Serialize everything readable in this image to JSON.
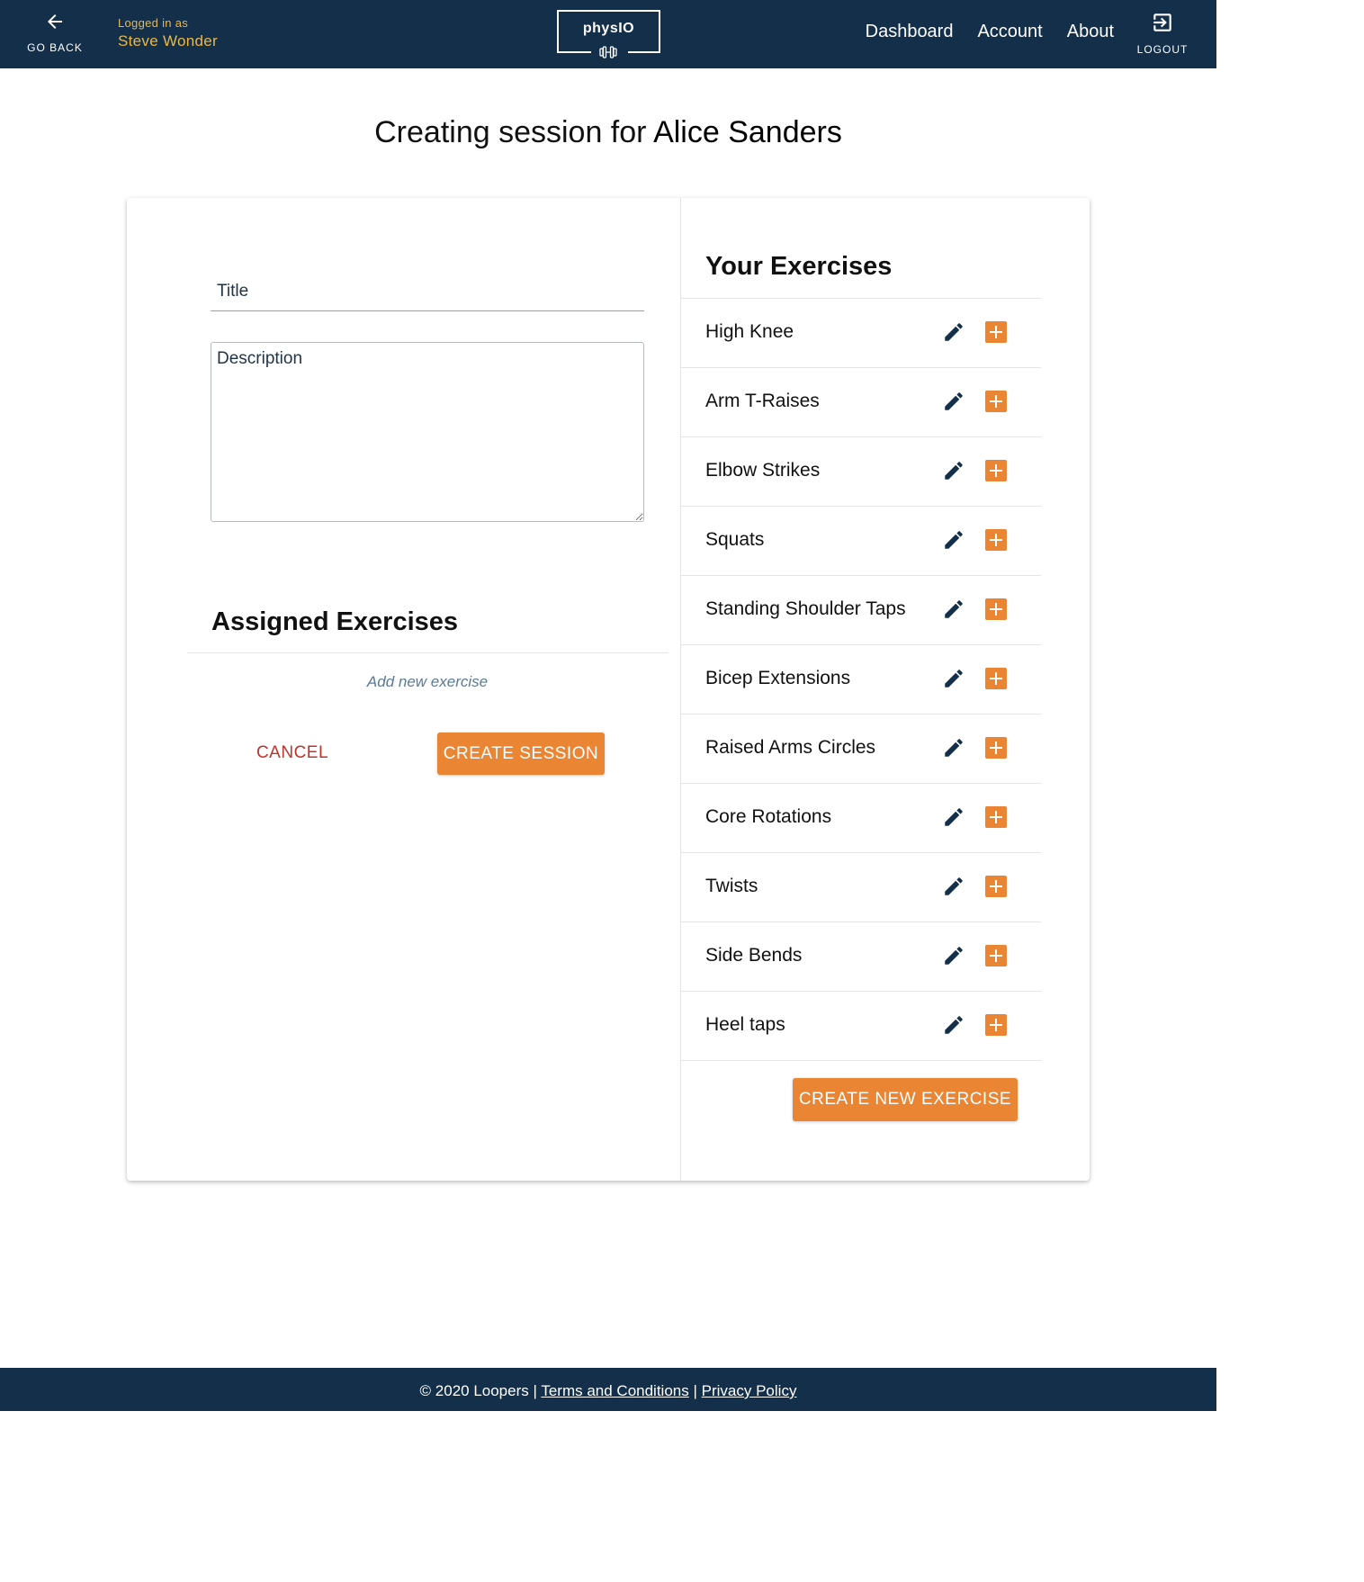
{
  "nav": {
    "go_back_label": "GO BACK",
    "logged_in_label": "Logged in as",
    "user_name": "Steve Wonder",
    "brand": "physIO",
    "links": [
      "Dashboard",
      "Account",
      "About"
    ],
    "logout_label": "LOGOUT"
  },
  "page": {
    "title_prefix": "Creating session for",
    "patient_name": "Alice Sanders"
  },
  "form": {
    "title_placeholder": "Title",
    "title_value": "",
    "description_placeholder": "Description",
    "description_value": ""
  },
  "assigned": {
    "heading": "Assigned Exercises",
    "add_new_label": "Add new exercise",
    "cancel_label": "CANCEL",
    "create_label": "CREATE SESSION"
  },
  "exercises": {
    "heading": "Your Exercises",
    "items": [
      "High Knee",
      "Arm T-Raises",
      "Elbow Strikes",
      "Squats",
      "Standing Shoulder Taps",
      "Bicep Extensions",
      "Raised Arms Circles",
      "Core Rotations",
      "Twists",
      "Side Bends",
      "Heel taps"
    ],
    "create_new_label": "CREATE NEW EXERCISE"
  },
  "footer": {
    "copyright": "© 2020 Loopers |",
    "terms": "Terms and Conditions",
    "separator": "|",
    "privacy": "Privacy Policy"
  },
  "colors": {
    "navy": "#132f4a",
    "accent": "#e98533",
    "user_gold": "#e8b84a",
    "cancel_red": "#c0332b"
  },
  "icons": {
    "go_back": "arrow-left-icon",
    "brand": "dumbbell-icon",
    "logout": "logout-icon",
    "edit": "pencil-icon",
    "add": "plus-box-icon"
  }
}
